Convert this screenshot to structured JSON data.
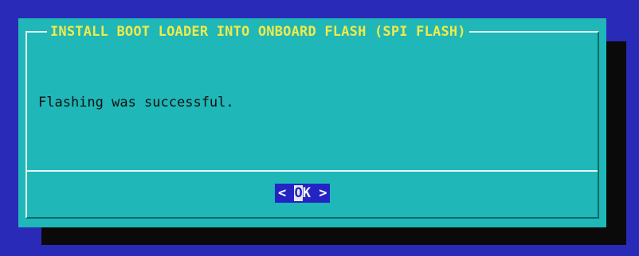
{
  "dialog": {
    "title": "INSTALL BOOT LOADER INTO ONBOARD FLASH (SPI FLASH)",
    "message": "Flashing was successful.",
    "ok_button": {
      "left": "< ",
      "hotkey": "O",
      "rest": "K",
      "right": " >"
    }
  },
  "colors": {
    "screen_background": "#2a2ab8",
    "dialog_background": "#1fb7b7",
    "title_text": "#f2e94a",
    "button_background": "#2424c4",
    "shadow": "#0a0a0a"
  }
}
